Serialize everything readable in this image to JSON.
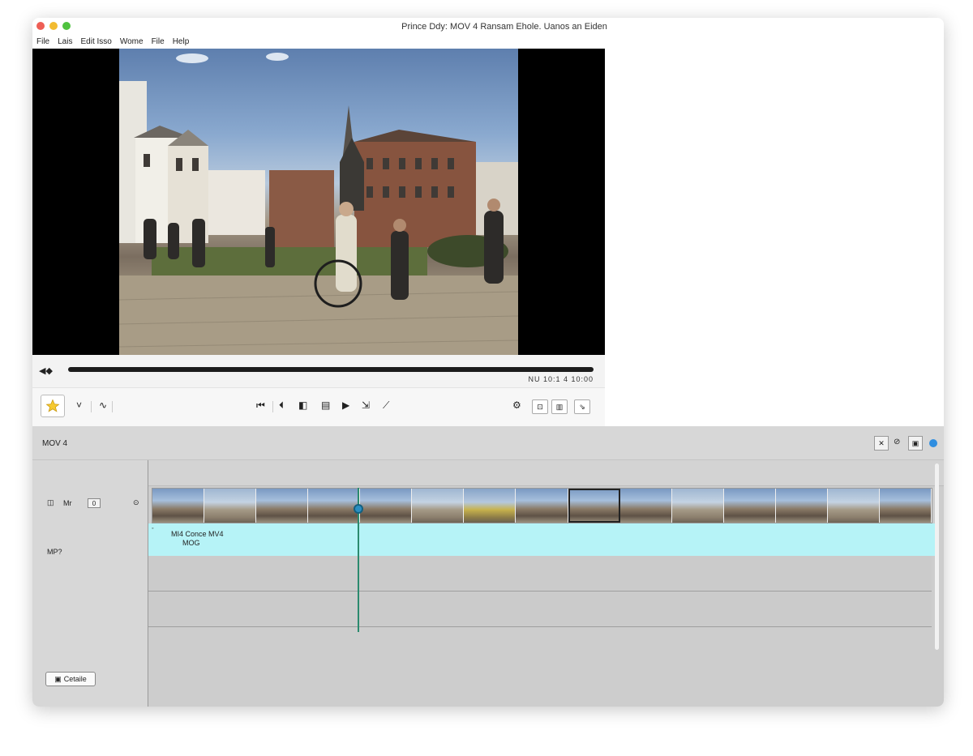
{
  "window": {
    "title": "Prince Ddy: MOV 4 Ransam Ehole. Uanos an Eiden"
  },
  "menu": {
    "items": [
      "File",
      "Lais",
      "Edit Isso",
      "Wome",
      "File",
      "Help"
    ]
  },
  "player": {
    "timecode": "NU  10:1 4     10:00",
    "progress": 1.0
  },
  "timeline": {
    "header_label": "MOV 4",
    "track_labels": {
      "video_label": "Mr",
      "video_value": "0",
      "audio_label": "MP?"
    },
    "audio_clip": {
      "line1": "MI4 Conce MV4",
      "line2": "MOG"
    },
    "filmstrip_frames": 15,
    "details_button": "Cetaile"
  },
  "colors": {
    "audio_clip": "#b6f3f7",
    "playhead": "#2b8a6e",
    "accent": "#2f8ee0",
    "star": "#f6c92f"
  }
}
